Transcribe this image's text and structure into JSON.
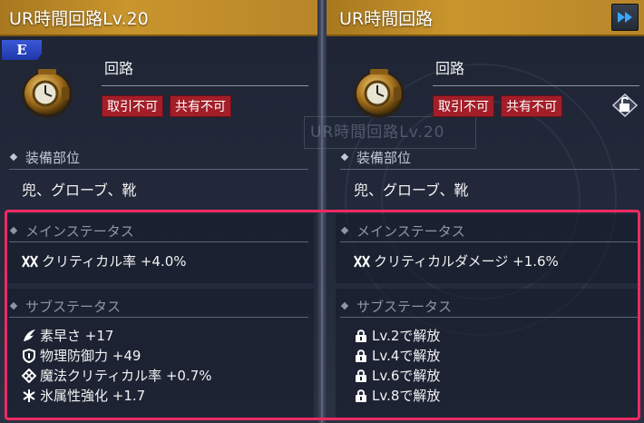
{
  "left_panel": {
    "title": "UR時間回路Lv.20",
    "rarity_badge": "E",
    "item_type": "回路",
    "tags": [
      "取引不可",
      "共有不可"
    ],
    "equip_slot_label": "装備部位",
    "equip_slot_value": "兜、グローブ、靴",
    "main_status_label": "メインステータス",
    "main_status": {
      "text": "クリティカル率 +4.0%",
      "icon": "crit-icon"
    },
    "sub_status_label": "サブステータス",
    "sub_status": [
      {
        "text": "素早さ +17",
        "icon": "wing-icon"
      },
      {
        "text": "物理防御力 +49",
        "icon": "shield-icon"
      },
      {
        "text": "魔法クリティカル率 +0.7%",
        "icon": "magic-crit-icon"
      },
      {
        "text": "氷属性強化 +1.7",
        "icon": "snowflake-icon"
      }
    ]
  },
  "right_panel": {
    "title": "UR時間回路",
    "item_type": "回路",
    "tags": [
      "取引不可",
      "共有不可"
    ],
    "equip_slot_label": "装備部位",
    "equip_slot_value": "兜、グローブ、靴",
    "main_status_label": "メインステータス",
    "main_status": {
      "text": "クリティカルダメージ +1.6%",
      "icon": "crit-icon"
    },
    "sub_status_label": "サブステータス",
    "sub_status": [
      {
        "text": "Lv.2で解放",
        "icon": "lock-icon"
      },
      {
        "text": "Lv.4で解放",
        "icon": "lock-icon"
      },
      {
        "text": "Lv.6で解放",
        "icon": "lock-icon"
      },
      {
        "text": "Lv.8で解放",
        "icon": "lock-icon"
      }
    ],
    "fast_forward_icon": "fast-forward-icon",
    "unlock_icon": "unlocked-padlock-icon"
  },
  "background": {
    "watermark": "UR時間回路Lv.20"
  },
  "colors": {
    "header_gold": "#c9952c",
    "tag_red": "#a31e28",
    "highlight_pink": "#ee2a63",
    "badge_blue": "#2a44c0"
  }
}
